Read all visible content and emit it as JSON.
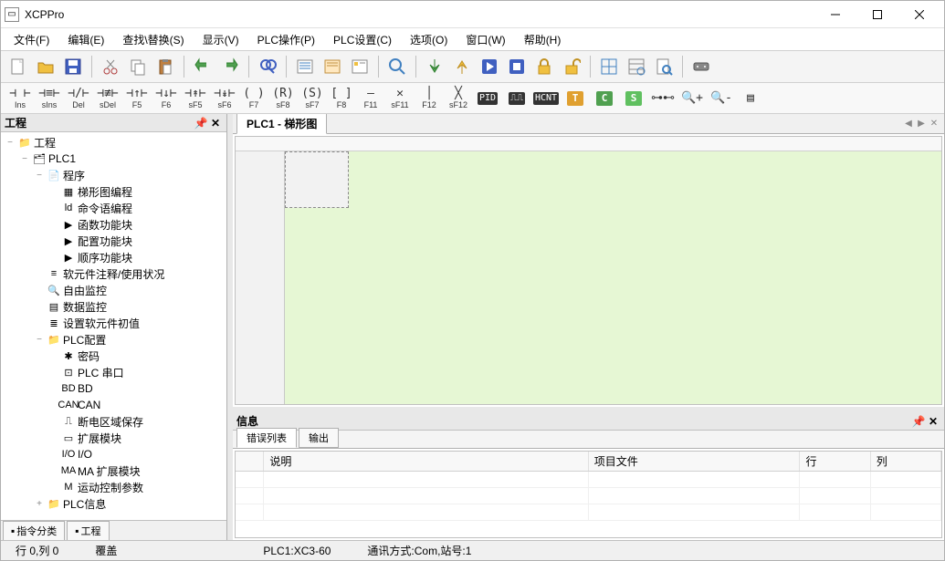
{
  "app": {
    "title": "XCPPro"
  },
  "menu": [
    "文件(F)",
    "编辑(E)",
    "查找\\替换(S)",
    "显示(V)",
    "PLC操作(P)",
    "PLC设置(C)",
    "选项(O)",
    "窗口(W)",
    "帮助(H)"
  ],
  "toolbar_main": [
    {
      "name": "new-file",
      "icon": "new"
    },
    {
      "name": "open-file",
      "icon": "open"
    },
    {
      "name": "save-file",
      "icon": "save"
    },
    {
      "name": "sep"
    },
    {
      "name": "cut",
      "icon": "cut"
    },
    {
      "name": "copy",
      "icon": "copy"
    },
    {
      "name": "paste",
      "icon": "paste"
    },
    {
      "name": "sep"
    },
    {
      "name": "undo",
      "icon": "undo"
    },
    {
      "name": "redo",
      "icon": "redo"
    },
    {
      "name": "sep"
    },
    {
      "name": "find",
      "icon": "find"
    },
    {
      "name": "sep"
    },
    {
      "name": "list1",
      "icon": "list"
    },
    {
      "name": "list2",
      "icon": "list2"
    },
    {
      "name": "list3",
      "icon": "list3"
    },
    {
      "name": "sep"
    },
    {
      "name": "zoom-tool",
      "icon": "zoom"
    },
    {
      "name": "sep"
    },
    {
      "name": "download",
      "icon": "dl"
    },
    {
      "name": "upload",
      "icon": "ul"
    },
    {
      "name": "run",
      "icon": "run"
    },
    {
      "name": "stop",
      "icon": "stop"
    },
    {
      "name": "lock",
      "icon": "lock"
    },
    {
      "name": "unlock",
      "icon": "unlock"
    },
    {
      "name": "sep"
    },
    {
      "name": "grid1",
      "icon": "grid"
    },
    {
      "name": "grid2",
      "icon": "grid2"
    },
    {
      "name": "preview",
      "icon": "preview"
    },
    {
      "name": "sep"
    },
    {
      "name": "device",
      "icon": "device"
    }
  ],
  "toolbar_ladder": [
    {
      "name": "no-contact",
      "sym": "⊣ ⊢",
      "lbl": "Ins"
    },
    {
      "name": "no-contact-s",
      "sym": "⊣≡⊢",
      "lbl": "sIns"
    },
    {
      "name": "nc-contact",
      "sym": "⊣/⊢",
      "lbl": "Del"
    },
    {
      "name": "nc-contact-s",
      "sym": "⊣≢⊢",
      "lbl": "sDel"
    },
    {
      "name": "rising",
      "sym": "⊣↑⊢",
      "lbl": "F5"
    },
    {
      "name": "falling",
      "sym": "⊣↓⊢",
      "lbl": "F6"
    },
    {
      "name": "rising-s",
      "sym": "⊣↟⊢",
      "lbl": "sF5"
    },
    {
      "name": "falling-s",
      "sym": "⊣↡⊢",
      "lbl": "sF6"
    },
    {
      "name": "coil",
      "sym": "( )",
      "lbl": "F7"
    },
    {
      "name": "reset-coil",
      "sym": "(R)",
      "lbl": "sF8"
    },
    {
      "name": "set-coil",
      "sym": "(S)",
      "lbl": "sF7"
    },
    {
      "name": "func",
      "sym": "[ ]",
      "lbl": "F8"
    },
    {
      "name": "hline",
      "sym": "—",
      "lbl": "F11"
    },
    {
      "name": "hline-del",
      "sym": "✕",
      "lbl": "sF11"
    },
    {
      "name": "vline",
      "sym": "│",
      "lbl": "F12"
    },
    {
      "name": "vline-del",
      "sym": "╳",
      "lbl": "sF12"
    },
    {
      "name": "pid-block",
      "sym": "PID",
      "lbl": "",
      "badge": true
    },
    {
      "name": "pulse-block",
      "sym": "⎍⎍",
      "lbl": "",
      "badge": true
    },
    {
      "name": "hcnt-block",
      "sym": "HCNT",
      "lbl": "",
      "badge": true
    },
    {
      "name": "t-block",
      "sym": "T",
      "lbl": "",
      "color": "#e0a030"
    },
    {
      "name": "c-block",
      "sym": "C",
      "lbl": "",
      "color": "#50a050"
    },
    {
      "name": "s-block",
      "sym": "S",
      "lbl": "",
      "color": "#60c060"
    },
    {
      "name": "link-block",
      "sym": "⊶⊷",
      "lbl": ""
    },
    {
      "name": "zoom-in",
      "sym": "🔍+",
      "lbl": ""
    },
    {
      "name": "zoom-out",
      "sym": "🔍-",
      "lbl": ""
    },
    {
      "name": "doc-view",
      "sym": "▤",
      "lbl": ""
    }
  ],
  "project_panel": {
    "title": "工程",
    "bottom_tabs": [
      "指令分类",
      "工程"
    ]
  },
  "tree": [
    {
      "d": 0,
      "t": "−",
      "i": "proj",
      "l": "工程"
    },
    {
      "d": 1,
      "t": "−",
      "i": "plc",
      "l": "PLC1"
    },
    {
      "d": 2,
      "t": "−",
      "i": "doc",
      "l": "程序"
    },
    {
      "d": 3,
      "t": "",
      "i": "lad",
      "l": "梯形图编程"
    },
    {
      "d": 3,
      "t": "",
      "i": "txt",
      "l": "命令语编程"
    },
    {
      "d": 3,
      "t": "",
      "i": "fn",
      "l": "函数功能块"
    },
    {
      "d": 3,
      "t": "",
      "i": "cfg",
      "l": "配置功能块"
    },
    {
      "d": 3,
      "t": "",
      "i": "seq",
      "l": "顺序功能块"
    },
    {
      "d": 2,
      "t": "",
      "i": "note",
      "l": "软元件注释/使用状况"
    },
    {
      "d": 2,
      "t": "",
      "i": "mon",
      "l": "自由监控"
    },
    {
      "d": 2,
      "t": "",
      "i": "dmon",
      "l": "数据监控"
    },
    {
      "d": 2,
      "t": "",
      "i": "init",
      "l": "设置软元件初值"
    },
    {
      "d": 2,
      "t": "−",
      "i": "fold",
      "l": "PLC配置"
    },
    {
      "d": 3,
      "t": "",
      "i": "pwd",
      "l": "密码"
    },
    {
      "d": 3,
      "t": "",
      "i": "ser",
      "l": "PLC 串口"
    },
    {
      "d": 3,
      "t": "",
      "i": "bd",
      "l": "BD"
    },
    {
      "d": 3,
      "t": "",
      "i": "can",
      "l": "CAN"
    },
    {
      "d": 3,
      "t": "",
      "i": "ret",
      "l": "断电区域保存"
    },
    {
      "d": 3,
      "t": "",
      "i": "ext",
      "l": "扩展模块"
    },
    {
      "d": 3,
      "t": "",
      "i": "io",
      "l": "I/O"
    },
    {
      "d": 3,
      "t": "",
      "i": "ma",
      "l": "MA 扩展模块"
    },
    {
      "d": 3,
      "t": "",
      "i": "mot",
      "l": "运动控制参数"
    },
    {
      "d": 2,
      "t": "+",
      "i": "fold",
      "l": "PLC信息"
    }
  ],
  "doc": {
    "tab": "PLC1 - 梯形图"
  },
  "info": {
    "title": "信息",
    "tabs": [
      "错误列表",
      "输出"
    ],
    "columns": [
      "",
      "说明",
      "项目文件",
      "行",
      "列"
    ]
  },
  "status": {
    "pos": "行 0,列 0",
    "mode": "覆盖",
    "plc": "PLC1:XC3-60",
    "comm": "通讯方式:Com,站号:1"
  }
}
